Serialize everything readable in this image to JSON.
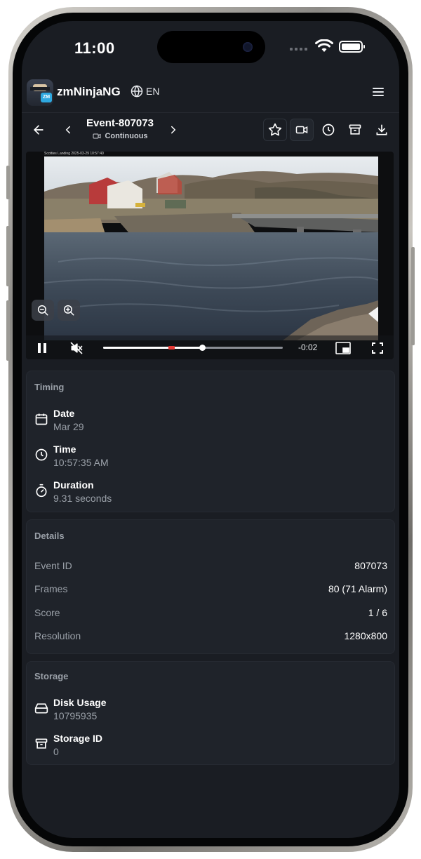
{
  "status_bar": {
    "time": "11:00"
  },
  "app": {
    "title": "zmNinjaNG",
    "language": "EN",
    "logo_badge": "ZM"
  },
  "event_nav": {
    "title": "Event-807073",
    "subtitle": "Continuous"
  },
  "video": {
    "osd_text": "Scotties Landing 2025-03-29 10:57:40",
    "remaining": "-0:02",
    "progress_fraction": 0.55,
    "alarm_marker_fraction": 0.38,
    "muted": true,
    "playing": true
  },
  "timing": {
    "title": "Timing",
    "rows": [
      {
        "icon": "calendar-icon",
        "label": "Date",
        "value": "Mar 29"
      },
      {
        "icon": "clock-icon",
        "label": "Time",
        "value": "10:57:35 AM"
      },
      {
        "icon": "stopwatch-icon",
        "label": "Duration",
        "value": "9.31 seconds"
      }
    ]
  },
  "details": {
    "title": "Details",
    "rows": [
      {
        "key": "Event ID",
        "value": "807073"
      },
      {
        "key": "Frames",
        "value": "80 (71 Alarm)"
      },
      {
        "key": "Score",
        "value": "1 / 6"
      },
      {
        "key": "Resolution",
        "value": "1280x800"
      }
    ]
  },
  "storage": {
    "title": "Storage",
    "rows": [
      {
        "icon": "hard-drive-icon",
        "label": "Disk Usage",
        "value": "10795935"
      },
      {
        "icon": "archive-icon",
        "label": "Storage ID",
        "value": "0"
      }
    ]
  }
}
